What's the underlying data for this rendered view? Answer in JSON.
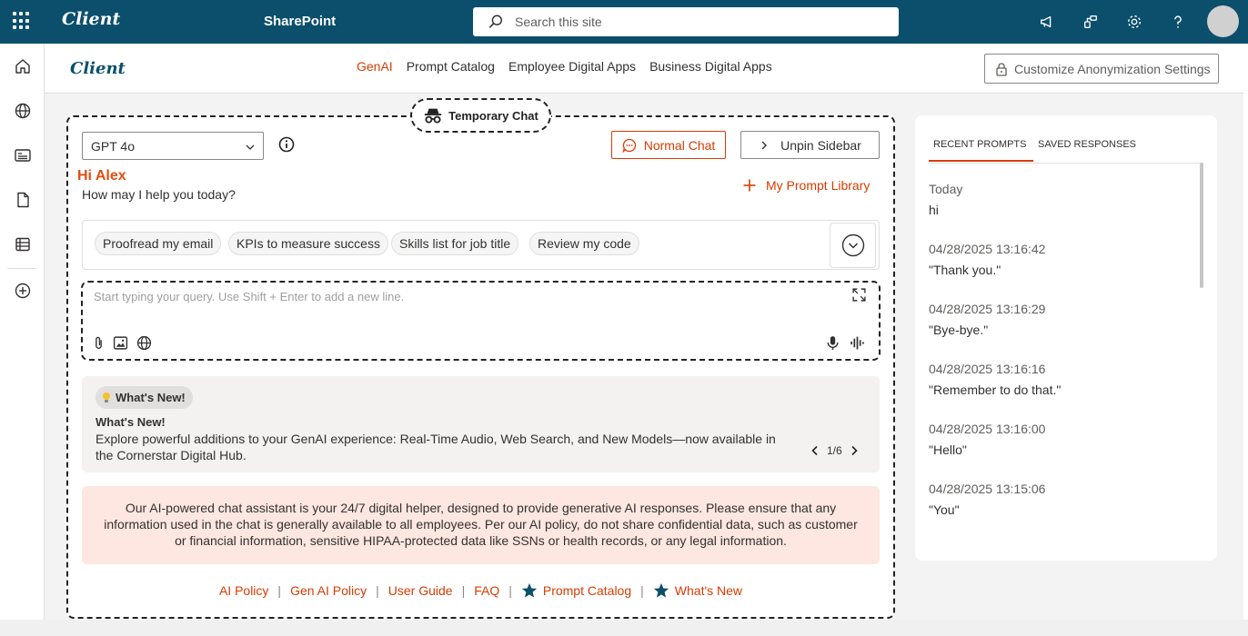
{
  "suite": {
    "brand": "Client",
    "app_name": "SharePoint",
    "search_placeholder": "Search this site",
    "icons": [
      "megaphone-icon",
      "share-icon",
      "gear-icon",
      "help-icon"
    ]
  },
  "site": {
    "logo_text": "Client",
    "nav": [
      "GenAI",
      "Prompt Catalog",
      "Employee Digital Apps",
      "Business Digital Apps"
    ],
    "active_nav": "GenAI",
    "customize_label": "Customize Anonymization Settings"
  },
  "rail_icons": [
    "home-icon",
    "globe-icon",
    "news-icon",
    "document-icon",
    "list-icon",
    "add-icon"
  ],
  "chat": {
    "temp_chat_label": "Temporary Chat",
    "model": "GPT 4o",
    "normal_chat_label": "Normal Chat",
    "unpin_label": "Unpin Sidebar",
    "greeting": "Hi Alex",
    "subgreeting": "How may I help you today?",
    "prompt_library_label": "My Prompt Library",
    "suggestions": [
      "Proofread my email",
      "KPIs to measure success",
      "Skills list for job title",
      "Review my code"
    ],
    "query_placeholder": "Start typing your query. Use Shift + Enter to add a new line.",
    "whats_new": {
      "pill": "What's New!",
      "title": "What's New!",
      "body": "Explore powerful additions to your GenAI experience: Real-Time Audio, Web Search, and New Models—now available in the Cornerstar Digital Hub.",
      "pager": "1/6"
    },
    "disclaimer": "Our AI-powered chat assistant is your 24/7 digital helper, designed to provide generative AI responses. Please ensure that any information used in the chat is generally available to all employees. Per our AI policy, do not share confidential data, such as customer or financial information, sensitive HIPAA-protected data like SSNs or health records, or any legal information.",
    "footer_links": [
      "AI Policy",
      "Gen AI Policy",
      "User Guide",
      "FAQ",
      "Prompt Catalog",
      "What's New"
    ]
  },
  "sidebar": {
    "tabs": [
      "RECENT PROMPTS",
      "SAVED RESPONSES"
    ],
    "active_tab": "RECENT PROMPTS",
    "items": [
      {
        "date": "Today",
        "text": "hi"
      },
      {
        "date": "04/28/2025 13:16:42",
        "text": "\"Thank you.\""
      },
      {
        "date": "04/28/2025 13:16:29",
        "text": "\"Bye-bye.\""
      },
      {
        "date": "04/28/2025 13:16:16",
        "text": "\"Remember to do that.\""
      },
      {
        "date": "04/28/2025 13:16:00",
        "text": "\"Hello\""
      },
      {
        "date": "04/28/2025 13:15:06",
        "text": "\"You\""
      }
    ]
  },
  "colors": {
    "suite_bar": "#0b4f6c",
    "accent": "#d83b01",
    "disclaimer_bg": "#fde7e0"
  }
}
